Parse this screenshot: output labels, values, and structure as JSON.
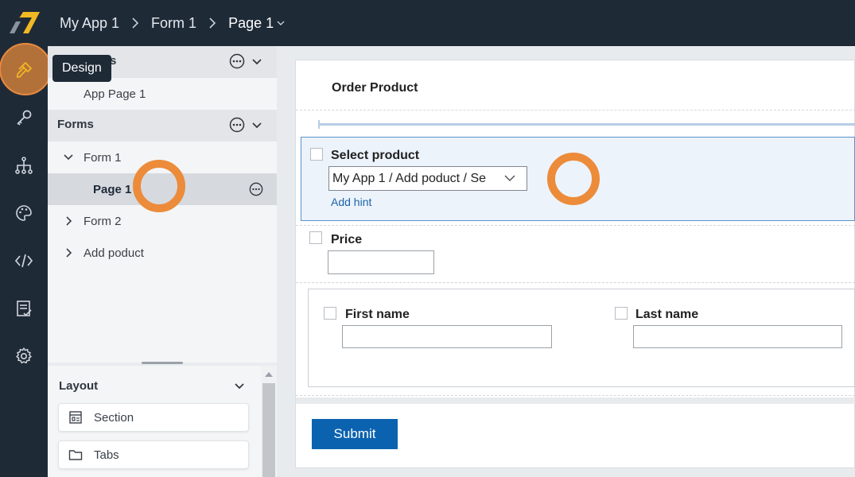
{
  "breadcrumb": {
    "app": "My App 1",
    "form": "Form 1",
    "page": "Page 1"
  },
  "rail": {
    "items": [
      {
        "name": "design",
        "icon": "paintbrush-icon",
        "active": true
      },
      {
        "name": "settings-key",
        "icon": "key-icon"
      },
      {
        "name": "workflow",
        "icon": "hierarchy-icon"
      },
      {
        "name": "theme",
        "icon": "palette-icon"
      },
      {
        "name": "code",
        "icon": "code-icon"
      },
      {
        "name": "data",
        "icon": "checklist-icon"
      },
      {
        "name": "app-settings",
        "icon": "gear-icon"
      }
    ],
    "tooltip": "Design"
  },
  "tree": {
    "app_pages_header_partial": "s",
    "app_page_1": "App Page 1",
    "forms_header": "Forms",
    "form1": "Form 1",
    "page1": "Page 1",
    "form2": "Form 2",
    "add_poduct": "Add poduct"
  },
  "layout_panel": {
    "title": "Layout",
    "items": [
      {
        "label": "Section",
        "icon": "section-icon"
      },
      {
        "label": "Tabs",
        "icon": "folder-icon"
      }
    ]
  },
  "form": {
    "title": "Order Product",
    "select_product": {
      "label": "Select product",
      "value": "My App 1 / Add poduct / Se",
      "hint_link": "Add hint"
    },
    "price": {
      "label": "Price",
      "value": ""
    },
    "first_name": {
      "label": "First name",
      "value": ""
    },
    "last_name": {
      "label": "Last name",
      "value": ""
    },
    "submit": "Submit"
  },
  "colors": {
    "topbar": "#1f2a37",
    "accent_orange": "#ec8b3a",
    "primary_blue": "#0b63b0",
    "selection_bg": "#edf3fb"
  }
}
